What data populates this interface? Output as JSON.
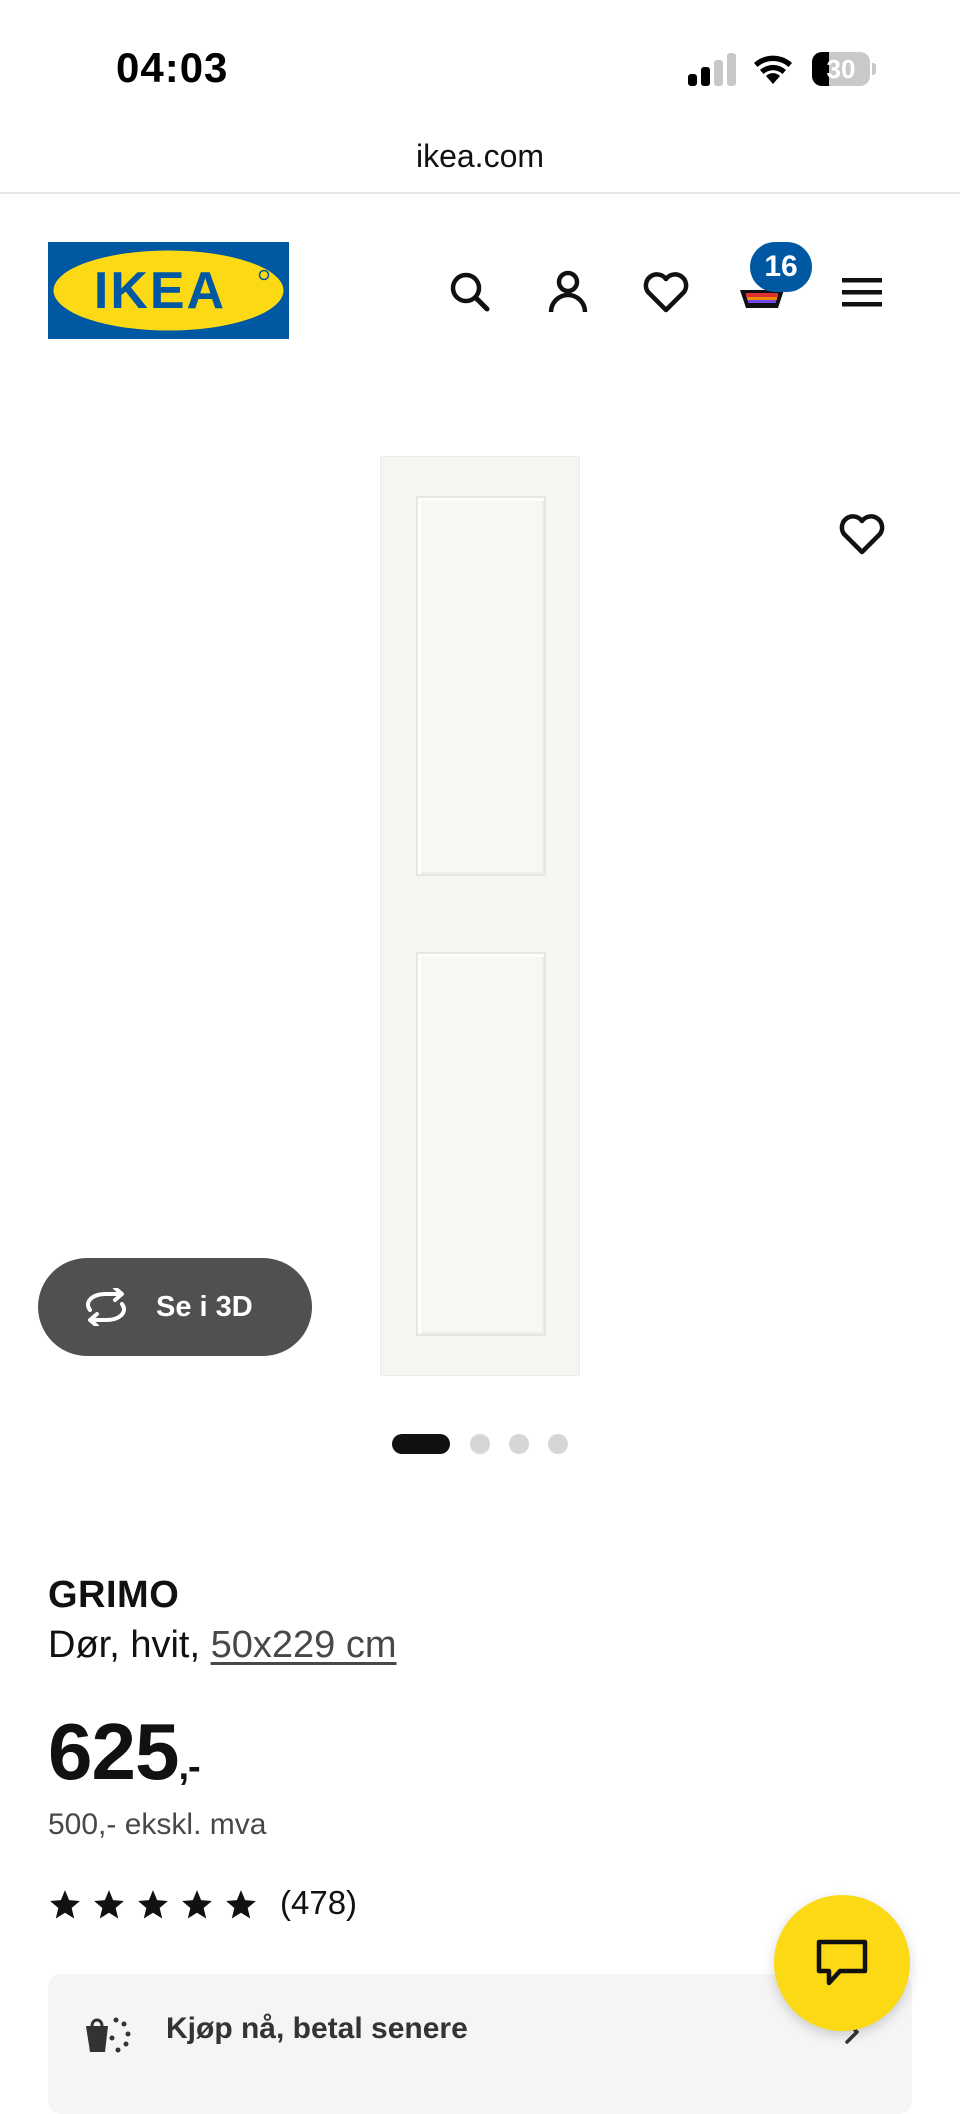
{
  "status_bar": {
    "time": "04:03",
    "battery": "30",
    "battery_level": 0.3
  },
  "browser": {
    "url": "ikea.com"
  },
  "header": {
    "logo_text": "IKEA",
    "cart_count": "16",
    "icons": [
      "search-icon",
      "account-icon",
      "heart-icon",
      "cart-icon",
      "menu-icon"
    ],
    "colors": {
      "brand_blue": "#0058a3",
      "brand_yellow": "#fbd914"
    }
  },
  "gallery": {
    "view_3d_label": "Se i 3D",
    "slide_count": 4,
    "active_slide": 1
  },
  "product": {
    "name": "GRIMO",
    "description": "Dør, hvit,",
    "size": "50x229 cm",
    "price": "625",
    "price_suffix": ",-",
    "price_ex_vat": "500,- ekskl. mva",
    "rating": 5,
    "review_count": "(478)"
  },
  "payment": {
    "label": "Kjøp nå, betal senere"
  }
}
